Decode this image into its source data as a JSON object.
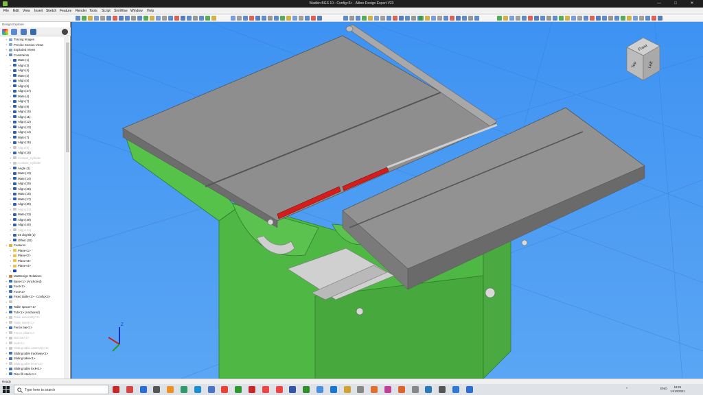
{
  "window": {
    "title": "Wadkin BGS 10 - Config<5> - Alibre Design Expert V23",
    "minimize": "—",
    "maximize": "□",
    "close": "✕"
  },
  "menu": [
    "File",
    "Edit",
    "View",
    "Insert",
    "Sketch",
    "Feature",
    "Render",
    "Tools",
    "Script",
    "SimWise",
    "Window",
    "Help"
  ],
  "sidebar": {
    "header": "Design Explorer",
    "tree": [
      {
        "label": "Tracing Images",
        "dim": false,
        "icon": "#7fa7d8"
      },
      {
        "label": "Precise Section Views",
        "dim": false,
        "icon": "#7fa7d8"
      },
      {
        "label": "Exploded Views",
        "dim": false,
        "icon": "#7fa7d8"
      },
      {
        "label": "Constraints",
        "dim": false,
        "icon": "#5b8ad1"
      },
      {
        "label": "Mate (1)",
        "dim": false,
        "icon": "#2f5fb0"
      },
      {
        "label": "Align (3)",
        "dim": false,
        "icon": "#2f5fb0"
      },
      {
        "label": "Align (4)",
        "dim": false,
        "icon": "#2f5fb0"
      },
      {
        "label": "Mate (2)",
        "dim": false,
        "icon": "#2f5fb0"
      },
      {
        "label": "Align (5)",
        "dim": false,
        "icon": "#2f5fb0"
      },
      {
        "label": "Align (6)",
        "dim": false,
        "icon": "#2f5fb0"
      },
      {
        "label": "Align (27)",
        "dim": false,
        "icon": "#2f5fb0"
      },
      {
        "label": "Mate (4)",
        "dim": false,
        "icon": "#2f5fb0"
      },
      {
        "label": "Align (7)",
        "dim": false,
        "icon": "#2f5fb0"
      },
      {
        "label": "Align (8)",
        "dim": false,
        "icon": "#2f5fb0"
      },
      {
        "label": "Align (10)",
        "dim": false,
        "icon": "#2f5fb0"
      },
      {
        "label": "Align (11)",
        "dim": false,
        "icon": "#2f5fb0"
      },
      {
        "label": "Align (12)",
        "dim": false,
        "icon": "#2f5fb0"
      },
      {
        "label": "Align (13)",
        "dim": false,
        "icon": "#2f5fb0"
      },
      {
        "label": "Align (14)",
        "dim": false,
        "icon": "#2f5fb0"
      },
      {
        "label": "Mate (7)",
        "dim": false,
        "icon": "#2f5fb0"
      },
      {
        "label": "Align (15)",
        "dim": false,
        "icon": "#2f5fb0"
      },
      {
        "label": "Align (9)",
        "dim": true,
        "icon": "#c8c8c8"
      },
      {
        "label": "Align (16)",
        "dim": false,
        "icon": "#2f5fb0"
      },
      {
        "label": "Contact_Cylinder",
        "dim": true,
        "icon": "#c8c8c8"
      },
      {
        "label": "Contact_Cylinder",
        "dim": true,
        "icon": "#c8c8c8"
      },
      {
        "label": "Angle (1)",
        "dim": false,
        "icon": "#2f5fb0"
      },
      {
        "label": "Mate (13)",
        "dim": false,
        "icon": "#2f5fb0"
      },
      {
        "label": "Mate (14)",
        "dim": false,
        "icon": "#2f5fb0"
      },
      {
        "label": "Align (20)",
        "dim": false,
        "icon": "#2f5fb0"
      },
      {
        "label": "Align (28)",
        "dim": false,
        "icon": "#2f5fb0"
      },
      {
        "label": "Mate (16)",
        "dim": false,
        "icon": "#2f5fb0"
      },
      {
        "label": "Mate (17)",
        "dim": false,
        "icon": "#2f5fb0"
      },
      {
        "label": "Align (30)",
        "dim": false,
        "icon": "#2f5fb0"
      },
      {
        "label": "Align (31)",
        "dim": true,
        "icon": "#c8c8c8"
      },
      {
        "label": "Mate (23)",
        "dim": false,
        "icon": "#2f5fb0"
      },
      {
        "label": "Align (39)",
        "dim": false,
        "icon": "#2f5fb0"
      },
      {
        "label": "Align (40)",
        "dim": false,
        "icon": "#2f5fb0"
      },
      {
        "label": "Align (41)",
        "dim": true,
        "icon": "#c8c8c8"
      },
      {
        "label": "45 deg/tilt (2)",
        "dim": false,
        "icon": "#2f5fb0"
      },
      {
        "label": "Offset (32)",
        "dim": false,
        "icon": "#2f5fb0"
      },
      {
        "label": "Features",
        "dim": false,
        "icon": "#e0b030"
      },
      {
        "label": "Plane<1>",
        "dim": false,
        "icon": "#f0c040"
      },
      {
        "label": "Plane<2>",
        "dim": false,
        "icon": "#f0c040"
      },
      {
        "label": "Plane<3>",
        "dim": false,
        "icon": "#f0c040"
      },
      {
        "label": "Plane<4>",
        "dim": false,
        "icon": "#f0c040"
      },
      {
        "label": "",
        "dim": false,
        "icon": "#1a3bbf"
      },
      {
        "label": "MatDesign Relations",
        "dim": false,
        "icon": "#d08030"
      },
      {
        "label": "Base<1> (Anchored)",
        "dim": false,
        "icon": "#3a70c0"
      },
      {
        "label": "Foot<1>",
        "dim": false,
        "icon": "#3a70c0"
      },
      {
        "label": "Foot<2>",
        "dim": false,
        "icon": "#3a70c0"
      },
      {
        "label": "Fixed table<1> - Config<2>",
        "dim": false,
        "icon": "#3a70c0"
      },
      {
        "label": "",
        "dim": true,
        "icon": "#c8c8c8"
      },
      {
        "label": "Table spacer<1>",
        "dim": false,
        "icon": "#3a70c0"
      },
      {
        "label": "Tub<1> (Anchored)",
        "dim": false,
        "icon": "#3a70c0"
      },
      {
        "label": "Table assembly<1>",
        "dim": true,
        "icon": "#c8c8c8"
      },
      {
        "label": "Table insert<1>",
        "dim": true,
        "icon": "#c8c8c8"
      },
      {
        "label": "Fence bar<1>",
        "dim": false,
        "icon": "#3a70c0"
      },
      {
        "label": "Fence pillar<1>",
        "dim": true,
        "icon": "#c8c8c8"
      },
      {
        "label": "Mot bar<1>",
        "dim": true,
        "icon": "#c8c8c8"
      },
      {
        "label": "Hub<1>",
        "dim": true,
        "icon": "#c8c8c8"
      },
      {
        "label": "Sliding table assembly<1>",
        "dim": true,
        "icon": "#c8c8c8"
      },
      {
        "label": "Sliding table trackway<1>",
        "dim": false,
        "icon": "#3a70c0"
      },
      {
        "label": "Sliding table<1>",
        "dim": false,
        "icon": "#3a70c0"
      },
      {
        "label": "Sliding table lever<1>",
        "dim": true,
        "icon": "#c8c8c8"
      },
      {
        "label": "Sliding table lock<1>",
        "dim": false,
        "icon": "#3a70c0"
      },
      {
        "label": "Rise fill stock<1>",
        "dim": false,
        "icon": "#3a70c0"
      }
    ]
  },
  "viewcube": {
    "face_top": "Front",
    "face_left": "Top",
    "face_right": "Left"
  },
  "triad": {
    "axis_z": "Z"
  },
  "status": {
    "text": "Ready"
  },
  "taskbar": {
    "search_placeholder": "Type here to search",
    "lang": "ENG",
    "time": "19:21",
    "date": "14/10/2021"
  },
  "colors": {
    "viewport_bg": "#4d9bf0",
    "table_top": "#8e8e8e",
    "body": "#5bc24f",
    "highlight": "#d41e1e"
  }
}
